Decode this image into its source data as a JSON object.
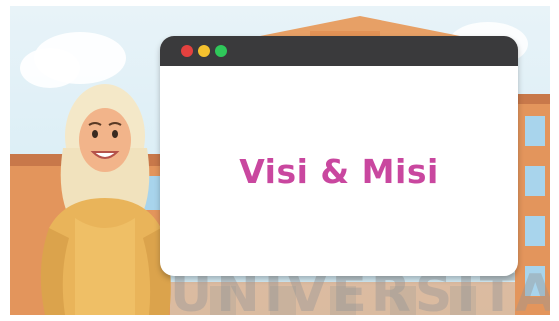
{
  "window": {
    "title_dots": [
      "close-dot",
      "minimize-dot",
      "maximize-dot"
    ],
    "headline": "Visi & Misi"
  },
  "watermark": {
    "text": "UNIVERSITA"
  },
  "colors": {
    "headline": "#c9479f",
    "titlebar": "#3a3a3c",
    "dot_red": "#e4413f",
    "dot_yellow": "#f4c12e",
    "dot_green": "#2fc85a",
    "building": "#e3955c",
    "sky": "#dbeef6"
  }
}
